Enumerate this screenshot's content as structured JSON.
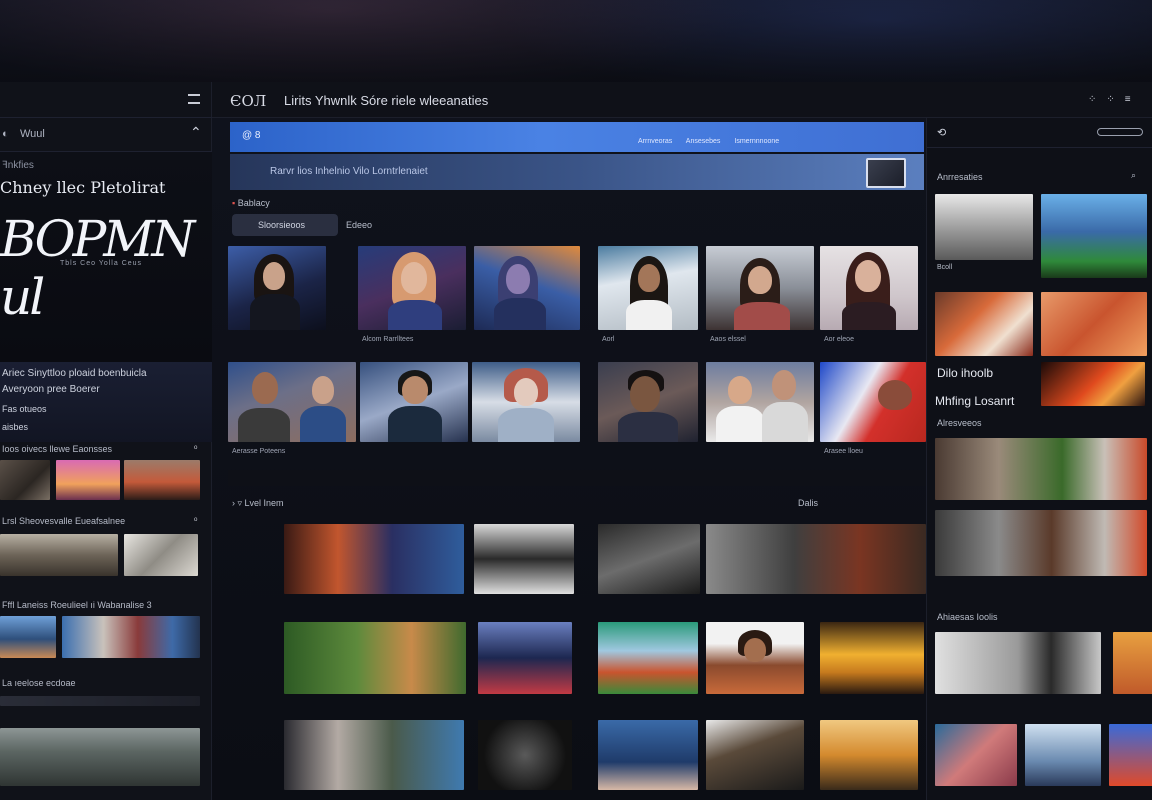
{
  "header": {
    "logo": "ЄOЛ",
    "title": "Lirits Yhwnlk Sóre riele wleeanaties",
    "icons": [
      "⁘",
      "⁘",
      "≡"
    ]
  },
  "sidebar": {
    "top_row_label": "Wuul",
    "hero_small": "ꟻnkfies",
    "hero_title": "Chney llec Pletolirat",
    "hero_logo": "BOPMN ul",
    "hero_caption": "Tbls Ceo Yolla Ceus",
    "info_lines": [
      "Ariec Sinyttloo ploaid boenbuicla",
      "Averyoon pree Boerer",
      "Fas otueos",
      "aisbes"
    ],
    "sections": [
      {
        "title": "Ioos oivecs llewe Eaonsses",
        "chev": "ᵒ"
      },
      {
        "title": "Lrsl Sheovesvalle Eueafsalnee",
        "chev": "ᵒ"
      },
      {
        "title": "Fffl Laneiss Roeulieel ıi Wabanalise 3",
        "chev": ""
      },
      {
        "title": "La ıeelose ecdoae",
        "chev": ""
      }
    ]
  },
  "banner": {
    "icon": "@ 8",
    "links": [
      "Arrnveoras",
      "Ansesebes",
      "Ismernnnoone"
    ],
    "subtitle": "Rarvr lios Inhelnio Vilo   Lorntrlenaiet"
  },
  "main": {
    "section1_title": "Bablacy",
    "tab_active": "Sloorsieoos",
    "tab_other": "Edeeo",
    "row1_captions": [
      "",
      "Alcom Rarrlltees",
      "",
      "Aorl",
      "Aaos elssel",
      "Aor eleoe"
    ],
    "row2_captions": [
      "Aerasse Poteens",
      "",
      "",
      "",
      "",
      "Arasee lloeu"
    ],
    "section2_title": "Lvel Inem",
    "section2_right": "Dalis"
  },
  "right_panel": {
    "title": "Anrresaties",
    "caption1": "Bcoll",
    "label_a": "Dilo ihoolb",
    "label_b": "Mhfing Losanrt",
    "section2": "Alresveeos",
    "section3": "Ahiaesas Ioolis"
  }
}
